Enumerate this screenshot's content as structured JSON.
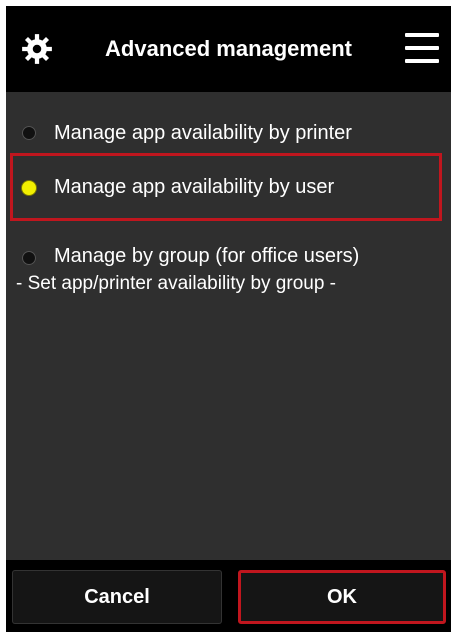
{
  "header": {
    "title": "Advanced management",
    "settings_icon": "gear-icon",
    "menu_icon": "hamburger-menu-icon"
  },
  "options": [
    {
      "label": "Manage app availability by printer",
      "selected": false
    },
    {
      "label": "Manage app availability by user",
      "selected": true,
      "highlighted": true
    },
    {
      "label": "Manage by group (for office users)",
      "sublabel": "- Set app/printer availability by group -",
      "selected": false
    }
  ],
  "footer": {
    "cancel_label": "Cancel",
    "ok_label": "OK"
  },
  "colors": {
    "background": "#2f2f2f",
    "bar": "#000000",
    "radio_selected": "#f2ef00",
    "highlight_border": "#c0161e",
    "text": "#ffffff"
  }
}
